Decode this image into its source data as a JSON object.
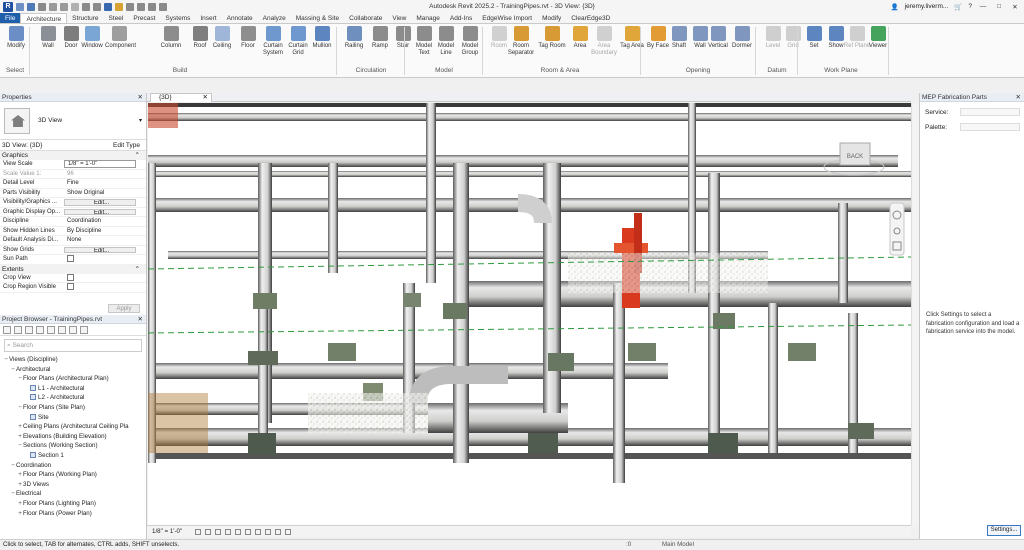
{
  "app": {
    "title": "Autodesk Revit 2025.2 - TrainingPipes.rvt - 3D View: {3D}",
    "user": "jeremy.liverm...",
    "help": "?"
  },
  "tabs": [
    {
      "label": "File"
    },
    {
      "label": "Architecture"
    },
    {
      "label": "Structure"
    },
    {
      "label": "Steel"
    },
    {
      "label": "Precast"
    },
    {
      "label": "Systems"
    },
    {
      "label": "Insert"
    },
    {
      "label": "Annotate"
    },
    {
      "label": "Analyze"
    },
    {
      "label": "Massing & Site"
    },
    {
      "label": "Collaborate"
    },
    {
      "label": "View"
    },
    {
      "label": "Manage"
    },
    {
      "label": "Add-Ins"
    },
    {
      "label": "EdgeWise Import"
    },
    {
      "label": "Modify"
    },
    {
      "label": "ClearEdge3D"
    }
  ],
  "ribbon": {
    "buttons": [
      {
        "label": "Modify",
        "icon": "modify-icon",
        "color": "#6c8ec7"
      },
      {
        "label": "Wall",
        "icon": "wall-icon",
        "color": "#8b8f96"
      },
      {
        "label": "Door",
        "icon": "door-icon",
        "color": "#7d7d7d"
      },
      {
        "label": "Window",
        "icon": "window-icon",
        "color": "#7aa6d6"
      },
      {
        "label": "Component",
        "icon": "component-icon",
        "color": "#9e9e9e"
      },
      {
        "label": "Column",
        "icon": "column-icon",
        "color": "#8d8d8d"
      },
      {
        "label": "Roof",
        "icon": "roof-icon",
        "color": "#7f7f7f"
      },
      {
        "label": "Ceiling",
        "icon": "ceiling-icon",
        "color": "#9fb6d8"
      },
      {
        "label": "Floor",
        "icon": "floor-icon",
        "color": "#8e8e8e"
      },
      {
        "label": "Curtain System",
        "icon": "curtain-system-icon",
        "color": "#6f98cf"
      },
      {
        "label": "Curtain Grid",
        "icon": "curtain-grid-icon",
        "color": "#6f98cf"
      },
      {
        "label": "Mullion",
        "icon": "mullion-icon",
        "color": "#5d86c0"
      },
      {
        "label": "Railing",
        "icon": "railing-icon",
        "color": "#6f8fbf"
      },
      {
        "label": "Ramp",
        "icon": "ramp-icon",
        "color": "#8c8c8c"
      },
      {
        "label": "Stair",
        "icon": "stair-icon",
        "color": "#8c8c8c"
      },
      {
        "label": "Model Text",
        "icon": "model-text-icon",
        "color": "#8c8c8c"
      },
      {
        "label": "Model Line",
        "icon": "model-line-icon",
        "color": "#8c8c8c"
      },
      {
        "label": "Model Group",
        "icon": "model-group-icon",
        "color": "#8c8c8c"
      },
      {
        "label": "Room",
        "icon": "room-icon",
        "color": "#d0d0d0"
      },
      {
        "label": "Room Separator",
        "icon": "room-separator-icon",
        "color": "#d89a35"
      },
      {
        "label": "Tag Room",
        "icon": "tag-room-icon",
        "color": "#d89a35"
      },
      {
        "label": "Area",
        "icon": "area-icon",
        "color": "#e0a63a"
      },
      {
        "label": "Area Boundary",
        "icon": "area-boundary-icon",
        "color": "#d0d0d0"
      },
      {
        "label": "Tag Area",
        "icon": "tag-area-icon",
        "color": "#e0a63a"
      },
      {
        "label": "By Face",
        "icon": "by-face-icon",
        "color": "#e39b36"
      },
      {
        "label": "Shaft",
        "icon": "shaft-icon",
        "color": "#7f97bf"
      },
      {
        "label": "Wall",
        "icon": "wall-opening-icon",
        "color": "#7f97bf"
      },
      {
        "label": "Vertical",
        "icon": "vertical-opening-icon",
        "color": "#7f97bf"
      },
      {
        "label": "Dormer",
        "icon": "dormer-icon",
        "color": "#7f97bf"
      },
      {
        "label": "Level",
        "icon": "level-icon",
        "color": "#cfcfcf"
      },
      {
        "label": "Grid",
        "icon": "grid-icon",
        "color": "#cfcfcf"
      },
      {
        "label": "Set",
        "icon": "set-workplane-icon",
        "color": "#5d86c0"
      },
      {
        "label": "Show",
        "icon": "show-workplane-icon",
        "color": "#5d86c0"
      },
      {
        "label": "Ref Plane",
        "icon": "ref-plane-icon",
        "color": "#cfcfcf"
      },
      {
        "label": "Viewer",
        "icon": "viewer-icon",
        "color": "#46a35b"
      }
    ],
    "panels": [
      {
        "label": "Select"
      },
      {
        "label": "Build"
      },
      {
        "label": "Circulation"
      },
      {
        "label": "Model"
      },
      {
        "label": "Room & Area"
      },
      {
        "label": "Opening"
      },
      {
        "label": "Datum"
      },
      {
        "label": "Work Plane"
      }
    ]
  },
  "properties": {
    "header": "Properties",
    "type_name": "3D View",
    "instance_label": "3D View: {3D}",
    "edit_type": "Edit Type",
    "group_graphics": "Graphics",
    "rows": [
      {
        "k": "View Scale",
        "v": "1/8\" = 1'-0\"",
        "kind": "box"
      },
      {
        "k": "Scale Value    1:",
        "v": "96",
        "kind": "dim"
      },
      {
        "k": "Detail Level",
        "v": "Fine",
        "kind": ""
      },
      {
        "k": "Parts Visibility",
        "v": "Show Original",
        "kind": ""
      },
      {
        "k": "Visibility/Graphics ...",
        "v": "Edit...",
        "kind": "btn"
      },
      {
        "k": "Graphic Display Op...",
        "v": "Edit...",
        "kind": "btn"
      },
      {
        "k": "Discipline",
        "v": "Coordination",
        "kind": ""
      },
      {
        "k": "Show Hidden Lines",
        "v": "By Discipline",
        "kind": ""
      },
      {
        "k": "Default Analysis Di...",
        "v": "None",
        "kind": ""
      },
      {
        "k": "Show Grids",
        "v": "Edit...",
        "kind": "btn"
      },
      {
        "k": "Sun Path",
        "v": "",
        "kind": "cb"
      }
    ],
    "group_extents": "Extents",
    "extent_rows": [
      {
        "k": "Crop View",
        "v": "",
        "kind": "cb"
      },
      {
        "k": "Crop Region Visible",
        "v": "",
        "kind": "cb"
      }
    ],
    "apply": "Apply"
  },
  "browser": {
    "header": "Project Browser - TrainingPipes.rvt",
    "search_placeholder": "Search",
    "items": [
      {
        "label": "Views (Discipline)",
        "toggle": "−",
        "indent": 0,
        "leaf": false
      },
      {
        "label": "Architectural",
        "toggle": "−",
        "indent": 1,
        "leaf": false
      },
      {
        "label": "Floor Plans (Architectural Plan)",
        "toggle": "−",
        "indent": 2,
        "leaf": false
      },
      {
        "label": "L1 - Architectural",
        "toggle": "",
        "indent": 3,
        "leaf": true
      },
      {
        "label": "L2 - Architectural",
        "toggle": "",
        "indent": 3,
        "leaf": true
      },
      {
        "label": "Floor Plans (Site Plan)",
        "toggle": "−",
        "indent": 2,
        "leaf": false
      },
      {
        "label": "Site",
        "toggle": "",
        "indent": 3,
        "leaf": true
      },
      {
        "label": "Ceiling Plans (Architectural Ceiling Pla",
        "toggle": "+",
        "indent": 2,
        "leaf": false
      },
      {
        "label": "Elevations (Building Elevation)",
        "toggle": "+",
        "indent": 2,
        "leaf": false
      },
      {
        "label": "Sections (Working Section)",
        "toggle": "−",
        "indent": 2,
        "leaf": false
      },
      {
        "label": "Section 1",
        "toggle": "",
        "indent": 3,
        "leaf": true
      },
      {
        "label": "Coordination",
        "toggle": "−",
        "indent": 1,
        "leaf": false
      },
      {
        "label": "Floor Plans (Working Plan)",
        "toggle": "+",
        "indent": 2,
        "leaf": false
      },
      {
        "label": "3D Views",
        "toggle": "+",
        "indent": 2,
        "leaf": false
      },
      {
        "label": "Electrical",
        "toggle": "−",
        "indent": 1,
        "leaf": false
      },
      {
        "label": "Floor Plans (Lighting Plan)",
        "toggle": "+",
        "indent": 2,
        "leaf": false
      },
      {
        "label": "Floor Plans (Power Plan)",
        "toggle": "+",
        "indent": 2,
        "leaf": false
      }
    ]
  },
  "view": {
    "tab_label": "{3D}",
    "scale": "1/8\" = 1'-0\"",
    "viewcube": "BACK"
  },
  "mep": {
    "header": "MEP Fabrication Parts",
    "service_label": "Service:",
    "palette_label": "Palette:",
    "message": "Click Settings to select a fabrication configuration and load a fabrication service into the model.",
    "settings": "Settings..."
  },
  "status": {
    "message": "Click to select, TAB for alternates, CTRL adds, SHIFT unselects.",
    "zero": ":0",
    "model": "Main Model"
  },
  "colors": {
    "file_tab": "#1f5eab",
    "accent": "#1f4fa3",
    "grid_line": "#2e9a3e",
    "valve_red": "#d8391f"
  }
}
